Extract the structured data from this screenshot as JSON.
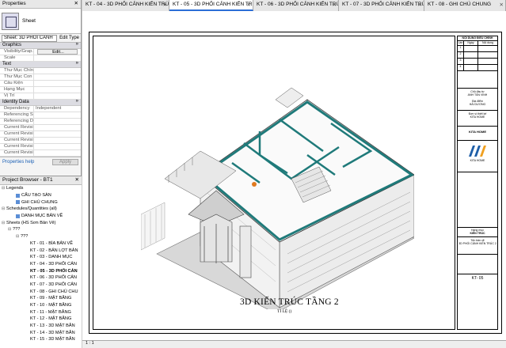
{
  "properties": {
    "title": "Properties",
    "type": "Sheet",
    "instance": "Sheet: 3D PHỐI CẢNH",
    "edit_type": "Edit Type",
    "help": "Properties help",
    "apply": "Apply",
    "groups": [
      {
        "name": "Graphics",
        "rows": [
          [
            "Visibility/Grap...",
            "Edit..."
          ],
          [
            "Scale",
            ""
          ]
        ]
      },
      {
        "name": "Text",
        "rows": [
          [
            "Thư Mục Chính",
            ""
          ],
          [
            "Thư Mục Con",
            ""
          ],
          [
            "Cấu Kiện",
            ""
          ],
          [
            "Hạng Mục",
            ""
          ],
          [
            "Vị Trí",
            ""
          ]
        ]
      },
      {
        "name": "Identity Data",
        "rows": [
          [
            "Dependency",
            "Independent"
          ],
          [
            "Referencing S...",
            ""
          ],
          [
            "Referencing D...",
            ""
          ],
          [
            "Current Revisi...",
            ""
          ],
          [
            "Current Revisi...",
            ""
          ],
          [
            "Current Revisi...",
            ""
          ],
          [
            "Current Revisi...",
            ""
          ],
          [
            "Current Revisi...",
            ""
          ]
        ]
      }
    ]
  },
  "browser": {
    "title": "Project Browser - BT1",
    "nodes": [
      [
        "⊟",
        "Legends",
        false,
        false
      ],
      [
        "",
        "CẤU TẠO SÀN",
        true,
        false
      ],
      [
        "",
        "GHI CHÚ CHUNG",
        true,
        false
      ],
      [
        "⊟",
        "Schedules/Quantities (all)",
        false,
        false
      ],
      [
        "",
        "DANH MỤC BẢN VẼ",
        true,
        false
      ],
      [
        "⊟",
        "Sheets (HS Sơn Bản Vẽ)",
        false,
        false
      ],
      [
        "⊟",
        "???",
        false,
        false
      ],
      [
        "⊟",
        "???",
        false,
        false
      ],
      [
        "",
        "KT - 01 - BÌA BẢN VẼ",
        false,
        false
      ],
      [
        "",
        "KT - 02 - BẢN LỢT BẢN",
        false,
        false
      ],
      [
        "",
        "KT - 03 - DANH MỤC",
        false,
        false
      ],
      [
        "",
        "KT - 04 - 3D PHỐI CẢN",
        false,
        false
      ],
      [
        "",
        "KT - 05 - 3D PHỐI CẢN",
        false,
        true
      ],
      [
        "",
        "KT - 06 - 3D PHỐI CẢN",
        false,
        false
      ],
      [
        "",
        "KT - 07 - 3D PHỐI CẢN",
        false,
        false
      ],
      [
        "",
        "KT - 08 - GHI CHÚ CHU",
        false,
        false
      ],
      [
        "",
        "KT - 09 - MẶT BẰNG",
        false,
        false
      ],
      [
        "",
        "KT - 10 - MẶT BẰNG",
        false,
        false
      ],
      [
        "",
        "KT - 11 - MẶT BẰNG",
        false,
        false
      ],
      [
        "",
        "KT - 12 - MẶT BẰNG",
        false,
        false
      ],
      [
        "",
        "KT - 13 - 3D MẶT BẰN",
        false,
        false
      ],
      [
        "",
        "KT - 14 - 3D MẶT BẰN",
        false,
        false
      ],
      [
        "",
        "KT - 15 - 3D MẶT BẰN",
        false,
        false
      ]
    ]
  },
  "tabs": [
    "KT - 04 - 3D PHỐI CẢNH KIẾN TRÚ...",
    "KT - 05 - 3D PHỐI CẢNH KIẾN TR...",
    "KT - 06 - 3D PHỐI CẢNH KIẾN TRÚ...",
    "KT - 07 - 3D PHỐI CẢNH KIẾN TRÚ...",
    "KT - 08 - GHI CHÚ CHUNG"
  ],
  "sheet": {
    "caption": "3D KIẾN TRÚC TẦNG 2",
    "scale": "TỈ LỆ ()",
    "titleblock": {
      "header": "NỘI DUNG ĐIỀU CHỈNH",
      "col_a": "Lần",
      "col_b": "Ngày",
      "col_c": "Nội dung",
      "rows": [
        "1",
        "2",
        "3",
        "4"
      ],
      "owner_label": "Chủ đầu tư",
      "owner": "ANH TÂN VINH",
      "address_label": "Địa điểm",
      "address": "HẢI DƯƠNG",
      "unit_label": "Đơn vị thiết kế",
      "unit": "KITA HOME",
      "company": "KITA HOME",
      "logo_text": "KITA HOME",
      "discipline_label": "Hạng mục",
      "discipline": "KIẾN TRÚC",
      "sheet_label": "Tên bản vẽ",
      "sheet_name": "3D PHỐI CẢNH KIẾN TRÚC 2",
      "number": "KT- 05"
    }
  },
  "status": {
    "scale": "1 : 1"
  }
}
